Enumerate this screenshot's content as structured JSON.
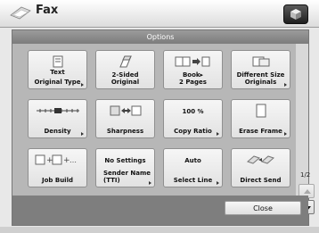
{
  "window": {
    "title": "Fax"
  },
  "header": {
    "options_label": "Options"
  },
  "tiles": [
    {
      "label": "Original Type",
      "value": "Text"
    },
    {
      "label": "2-Sided\nOriginal"
    },
    {
      "label": "Book▸\n2 Pages"
    },
    {
      "label": "Different Size\nOriginals"
    },
    {
      "label": "Density"
    },
    {
      "label": "Sharpness"
    },
    {
      "label": "Copy Ratio",
      "value": "100 %"
    },
    {
      "label": "Erase Frame"
    },
    {
      "label": "Job Build"
    },
    {
      "label": "Sender Name\n(TTI)",
      "value": "No Settings"
    },
    {
      "label": "Select Line",
      "value": "Auto"
    },
    {
      "label": "Direct Send"
    }
  ],
  "pager": {
    "page": "1/2"
  },
  "buttons": {
    "close": "Close"
  },
  "icons": {
    "app": "fax-icon",
    "corner": "system-icon",
    "text_doc": "text-document-icon",
    "two_sided": "two-sided-original-icon",
    "book": "book-to-2-pages-icon",
    "different_size": "different-size-originals-icon",
    "density": "density-scale-icon",
    "sharpness": "sharpness-icon",
    "erase_frame": "erase-frame-icon",
    "job_build": "job-build-icon",
    "direct_send": "direct-send-icon",
    "page_up": "arrow-up-icon",
    "page_down": "arrow-down-icon"
  }
}
